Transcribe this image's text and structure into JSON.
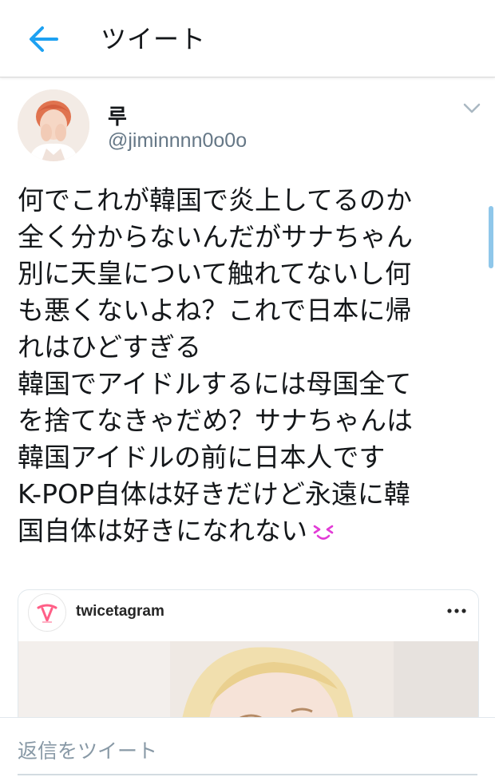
{
  "header": {
    "back_icon": "arrow-left-icon",
    "title": "ツイート",
    "accent_color": "#1da1f2"
  },
  "tweet": {
    "display_name": "루",
    "handle": "@jiminnnn0o0o",
    "text_lines": [
      "何でこれが韓国で炎上してるのか",
      "全く分からないんだがサナちゃん",
      "別に天皇について触れてないし何",
      "も悪くないよね？これで日本に帰",
      "れはひどすぎる",
      "韓国でアイドルするには母国全て",
      "を捨てなきゃだめ？サナちゃんは",
      "韓国アイドルの前に日本人です",
      "K-POP自体は好きだけど永遠に韓",
      "国自体は好きになれない"
    ],
    "trailing_emoji": "squinting-face-emoji",
    "embed": {
      "account": "twicetagram",
      "logo_icon": "twice-logo-icon",
      "more_icon": "more-horizontal-icon"
    }
  },
  "reply": {
    "placeholder": "返信をツイート"
  }
}
